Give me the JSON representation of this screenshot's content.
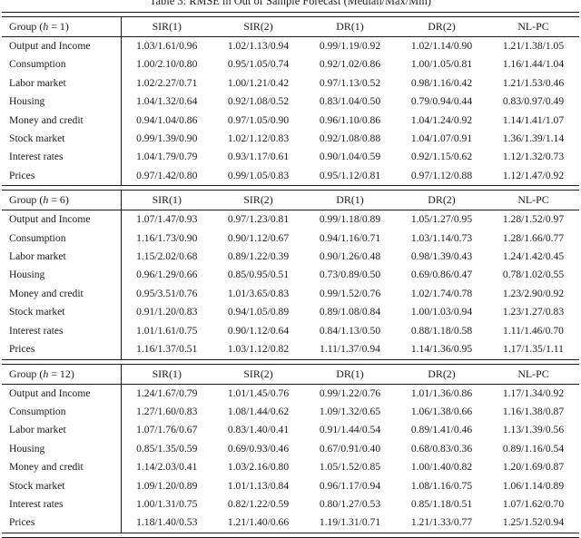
{
  "caption": {
    "text": "Table 3: RMSE in Out of Sample Forecast (Median/Max/Min)"
  },
  "table": {
    "columns": [
      "SIR(1)",
      "SIR(2)",
      "DR(1)",
      "DR(2)",
      "NL-PC"
    ],
    "row_labels": [
      "Output and Income",
      "Consumption",
      "Labor market",
      "Housing",
      "Money and credit",
      "Stock market",
      "Interest rates",
      "Prices"
    ],
    "groups": [
      {
        "header": "Group (h = 1)",
        "col_headers": [
          "SIR(1)",
          "SIR(2)",
          "DR(1)",
          "DR(2)",
          "NL-PC"
        ],
        "rows": [
          {
            "label": "Output and Income",
            "values": [
              "1.03/1.61/0.96",
              "1.02/1.13/0.94",
              "0.99/1.19/0.92",
              "1.02/1.14/0.90",
              "1.21/1.38/1.05"
            ]
          },
          {
            "label": "Consumption",
            "values": [
              "1.00/2.10/0.80",
              "0.95/1.05/0.74",
              "0.92/1.02/0.86",
              "1.00/1.05/0.81",
              "1.16/1.44/1.04"
            ]
          },
          {
            "label": "Labor market",
            "values": [
              "1.02/2.27/0.71",
              "1.00/1.21/0.42",
              "0.97/1.13/0.52",
              "0.98/1.16/0.42",
              "1.21/1.53/0.46"
            ]
          },
          {
            "label": "Housing",
            "values": [
              "1.04/1.32/0.64",
              "0.92/1.08/0.52",
              "0.83/1.04/0.50",
              "0.79/0.94/0.44",
              "0.83/0.97/0.49"
            ]
          },
          {
            "label": "Money and credit",
            "values": [
              "0.94/1.04/0.86",
              "0.97/1.05/0.90",
              "0.96/1.10/0.86",
              "1.04/1.24/0.92",
              "1.14/1.41/1.07"
            ]
          },
          {
            "label": "Stock market",
            "values": [
              "0.99/1.39/0.90",
              "1.02/1.12/0.83",
              "0.92/1.08/0.88",
              "1.04/1.07/0.91",
              "1.36/1.39/1.14"
            ]
          },
          {
            "label": "Interest rates",
            "values": [
              "1.04/1.79/0.79",
              "0.93/1.17/0.61",
              "0.90/1.04/0.59",
              "0.92/1.15/0.62",
              "1.12/1.32/0.73"
            ]
          },
          {
            "label": "Prices",
            "values": [
              "0.97/1.42/0.80",
              "0.99/1.05/0.83",
              "0.95/1.12/0.81",
              "0.97/1.12/0.88",
              "1.12/1.47/0.92"
            ]
          }
        ]
      },
      {
        "header": "Group (h = 6)",
        "col_headers": [
          "SIR(1)",
          "SIR(2)",
          "DR(1)",
          "DR(2)",
          "NL-PC"
        ],
        "rows": [
          {
            "label": "Output and Income",
            "values": [
              "1.07/1.47/0.93",
              "0.97/1.23/0.81",
              "0.99/1.18/0.89",
              "1.05/1.27/0.95",
              "1.28/1.52/0.97"
            ]
          },
          {
            "label": "Consumption",
            "values": [
              "1.16/1.73/0.90",
              "0.90/1.12/0.67",
              "0.94/1.16/0.71",
              "1.03/1.14/0.73",
              "1.28/1.66/0.77"
            ]
          },
          {
            "label": "Labor market",
            "values": [
              "1.15/2.02/0.68",
              "0.89/1.22/0.39",
              "0.90/1.26/0.48",
              "0.98/1.39/0.43",
              "1.24/1.42/0.45"
            ]
          },
          {
            "label": "Housing",
            "values": [
              "0.96/1.29/0.66",
              "0.85/0.95/0.51",
              "0.73/0.89/0.50",
              "0.69/0.86/0.47",
              "0.78/1.02/0.55"
            ]
          },
          {
            "label": "Money and credit",
            "values": [
              "0.95/3.51/0.76",
              "1.01/3.65/0.83",
              "0.99/1.52/0.76",
              "1.02/1.74/0.78",
              "1.23/2.90/0.92"
            ]
          },
          {
            "label": "Stock market",
            "values": [
              "0.91/1.20/0.83",
              "0.94/1.05/0.89",
              "0.89/1.08/0.84",
              "1.00/1.03/0.94",
              "1.23/1.27/0.83"
            ]
          },
          {
            "label": "Interest rates",
            "values": [
              "1.01/1.61/0.75",
              "0.90/1.12/0.64",
              "0.84/1.13/0.50",
              "0.88/1.18/0.58",
              "1.11/1.46/0.70"
            ]
          },
          {
            "label": "Prices",
            "values": [
              "1.16/1.37/0.51",
              "1.03/1.12/0.82",
              "1.11/1.37/0.94",
              "1.14/1.36/0.95",
              "1.17/1.35/1.11"
            ]
          }
        ]
      },
      {
        "header": "Group (h = 12)",
        "col_headers": [
          "SIR(1)",
          "SIR(2)",
          "DR(1)",
          "DR(2)",
          "NL-PC"
        ],
        "rows": [
          {
            "label": "Output and Income",
            "values": [
              "1.24/1.67/0.79",
              "1.01/1.45/0.76",
              "0.99/1.22/0.76",
              "1.01/1.36/0.86",
              "1.17/1.34/0.92"
            ]
          },
          {
            "label": "Consumption",
            "values": [
              "1.27/1.60/0.83",
              "1.08/1.44/0.62",
              "1.09/1.32/0.65",
              "1.06/1.38/0.66",
              "1.16/1.38/0.87"
            ]
          },
          {
            "label": "Labor market",
            "values": [
              "1.07/1.76/0.67",
              "0.83/1.40/0.41",
              "0.91/1.44/0.54",
              "0.89/1.41/0.46",
              "1.13/1.39/0.56"
            ]
          },
          {
            "label": "Housing",
            "values": [
              "0.85/1.35/0.59",
              "0.69/0.93/0.46",
              "0.67/0.91/0.40",
              "0.68/0.83/0.36",
              "0.89/1.16/0.54"
            ]
          },
          {
            "label": "Money and credit",
            "values": [
              "1.14/2.03/0.41",
              "1.03/2.16/0.80",
              "1.05/1.52/0.85",
              "1.00/1.40/0.82",
              "1.20/1.69/0.87"
            ]
          },
          {
            "label": "Stock market",
            "values": [
              "1.09/1.20/0.89",
              "1.01/1.13/0.84",
              "0.96/1.17/0.94",
              "1.08/1.16/0.75",
              "1.06/1.14/0.89"
            ]
          },
          {
            "label": "Interest rates",
            "values": [
              "1.00/1.31/0.75",
              "0.82/1.22/0.59",
              "0.80/1.27/0.53",
              "0.85/1.18/0.51",
              "1.07/1.62/0.70"
            ]
          },
          {
            "label": "Prices",
            "values": [
              "1.18/1.40/0.53",
              "1.21/1.40/0.66",
              "1.19/1.31/0.71",
              "1.21/1.33/0.77",
              "1.25/1.52/0.94"
            ]
          }
        ]
      }
    ]
  }
}
